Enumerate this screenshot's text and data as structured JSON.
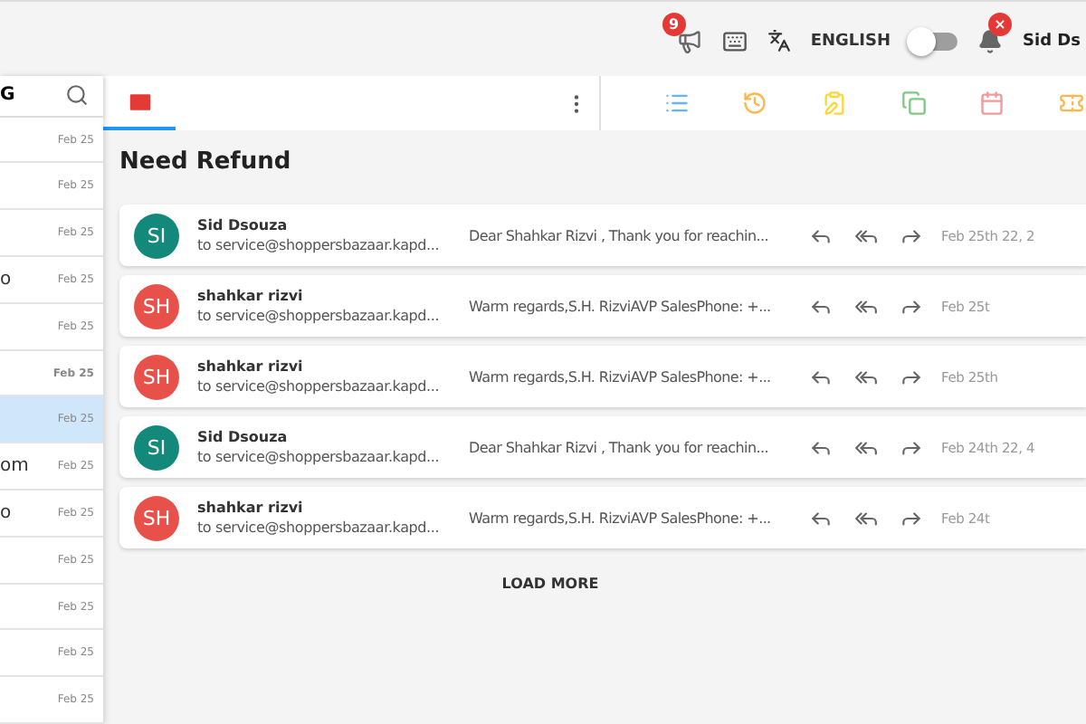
{
  "topbar": {
    "announcement_count": "9",
    "language": "ENGLISH",
    "dark_mode": false,
    "notification_badge": "×",
    "user": "Sid Ds"
  },
  "sidebar": {
    "header": "G",
    "items": [
      {
        "date": "Feb 25",
        "unread": false,
        "selected": false
      },
      {
        "date": "Feb 25",
        "unread": false,
        "selected": false
      },
      {
        "date": "Feb 25",
        "unread": false,
        "selected": false
      },
      {
        "text": "o",
        "date": "Feb 25",
        "unread": false,
        "selected": false
      },
      {
        "date": "Feb 25",
        "unread": false,
        "selected": false
      },
      {
        "date": "Feb 25",
        "unread": true,
        "selected": false
      },
      {
        "date": "Feb 25",
        "unread": false,
        "selected": true
      },
      {
        "text": "om",
        "date": "Feb 25",
        "unread": false,
        "selected": false
      },
      {
        "text": "o",
        "date": "Feb 25",
        "unread": false,
        "selected": false
      },
      {
        "date": "Feb 25",
        "unread": false,
        "selected": false
      },
      {
        "date": "Feb 25",
        "unread": false,
        "selected": false
      },
      {
        "date": "Feb 25",
        "unread": false,
        "selected": false
      },
      {
        "date": "Feb 25",
        "unread": false,
        "selected": false
      }
    ]
  },
  "subject": "Need Refund",
  "messages": [
    {
      "initials": "SI",
      "color": "#12897a",
      "sender": "Sid Dsouza",
      "to": "to service@shoppersbazaar.kapd...",
      "snippet": "Dear Shahkar Rizvi , Thank you for reachin...",
      "date": "Feb 25th 22, 2"
    },
    {
      "initials": "SH",
      "color": "#e8504a",
      "sender": "shahkar rizvi",
      "to": "to service@shoppersbazaar.kapd...",
      "snippet": "Warm regards,S.H. RizviAVP SalesPhone: +...",
      "date": "Feb 25t"
    },
    {
      "initials": "SH",
      "color": "#e8504a",
      "sender": "shahkar rizvi",
      "to": "to service@shoppersbazaar.kapd...",
      "snippet": "Warm regards,S.H. RizviAVP SalesPhone: +...",
      "date": "Feb 25th"
    },
    {
      "initials": "SI",
      "color": "#12897a",
      "sender": "Sid Dsouza",
      "to": "to service@shoppersbazaar.kapd...",
      "snippet": "Dear Shahkar Rizvi , Thank you for reachin...",
      "date": "Feb 24th 22, 4"
    },
    {
      "initials": "SH",
      "color": "#e8504a",
      "sender": "shahkar rizvi",
      "to": "to service@shoppersbazaar.kapd...",
      "snippet": "Warm regards,S.H. RizviAVP SalesPhone: +...",
      "date": "Feb 24t"
    }
  ],
  "load_more": "LOAD MORE"
}
